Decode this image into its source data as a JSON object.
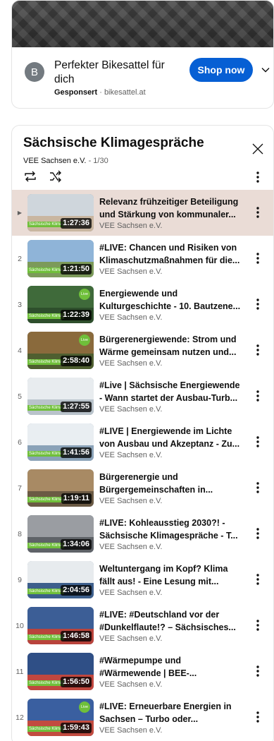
{
  "ad": {
    "avatar_letter": "B",
    "title": "Perfekter Bikesattel für dich",
    "sponsored_label": "Gesponsert",
    "separator": "·",
    "domain": "bikesattel.at",
    "shop_label": "Shop now"
  },
  "playlist": {
    "title": "Sächsische Klimagespräche",
    "channel": "VEE Sachsen e.V.",
    "separator": "-",
    "position": "1/30",
    "videos": [
      {
        "index": "▶",
        "title": "Relevanz frühzeitiger Beteiligung und Stärkung von kommunaler...",
        "channel": "VEE Sachsen e.V.",
        "duration": "1:27:36",
        "active": true,
        "sky": "#cfd6dc",
        "ground": "#c9b6a0",
        "live": false
      },
      {
        "index": "2",
        "title": "#LIVE: Chancen und Risiken von Klimaschutzmaßnahmen für die...",
        "channel": "VEE Sachsen e.V.",
        "duration": "1:21:50",
        "active": false,
        "sky": "#8fb4d8",
        "ground": "#7c9a5a",
        "live": false
      },
      {
        "index": "3",
        "title": "Energiewende und Kulturgeschichte - 10. Bautzene...",
        "channel": "VEE Sachsen e.V.",
        "duration": "1:22:39",
        "active": false,
        "sky": "#3f6a3a",
        "ground": "#2e4f2c",
        "live": true
      },
      {
        "index": "4",
        "title": "Bürgerenergiewende: Strom und Wärme gemeinsam nutzen und...",
        "channel": "VEE Sachsen e.V.",
        "duration": "2:58:40",
        "active": false,
        "sky": "#8a6a3c",
        "ground": "#4f5f30",
        "live": true
      },
      {
        "index": "5",
        "title": "#Live | Sächsische Energiewende - Wann startet der Ausbau-Turb...",
        "channel": "VEE Sachsen e.V.",
        "duration": "1:27:55",
        "active": false,
        "sky": "#e8ecef",
        "ground": "#b9c3cb",
        "live": false
      },
      {
        "index": "6",
        "title": "#LIVE | Energiewende im Lichte von Ausbau und Akzeptanz - Zu...",
        "channel": "VEE Sachsen e.V.",
        "duration": "1:41:56",
        "active": false,
        "sky": "#e9eef2",
        "ground": "#8aa2b8",
        "live": false
      },
      {
        "index": "7",
        "title": "Bürgerenergie und Bürgergemeinschaften in...",
        "channel": "VEE Sachsen e.V.",
        "duration": "1:19:11",
        "active": false,
        "sky": "#a88a64",
        "ground": "#6b5a44",
        "live": false
      },
      {
        "index": "8",
        "title": "#LIVE: Kohleausstieg 2030?! - Sächsische Klimagespräche - T...",
        "channel": "VEE Sachsen e.V.",
        "duration": "1:34:06",
        "active": false,
        "sky": "#9a9da2",
        "ground": "#5f6368",
        "live": false
      },
      {
        "index": "9",
        "title": "Weltuntergang im Kopf? Klima fällt aus! - Eine Lesung mit...",
        "channel": "VEE Sachsen e.V.",
        "duration": "2:04:56",
        "active": false,
        "sky": "#e7ebee",
        "ground": "#3d5f8c",
        "live": false
      },
      {
        "index": "10",
        "title": "#LIVE: #Deutschland vor der #Dunkelflaute!? – Sächsisches...",
        "channel": "VEE Sachsen e.V.",
        "duration": "1:46:58",
        "active": false,
        "sky": "#3c5e96",
        "ground": "#b9433c",
        "live": false
      },
      {
        "index": "11",
        "title": "#Wärmepumpe und #Wärmewende | BEE-...",
        "channel": "VEE Sachsen e.V.",
        "duration": "1:56:50",
        "active": false,
        "sky": "#2f4f86",
        "ground": "#c0473f",
        "live": false
      },
      {
        "index": "12",
        "title": "#LIVE: Erneuerbare Energien in Sachsen – Turbo oder...",
        "channel": "VEE Sachsen e.V.",
        "duration": "1:59:43",
        "active": false,
        "sky": "#3a5fa0",
        "ground": "#c24b40",
        "live": true
      }
    ]
  },
  "thumb_badge_text": "Sächsische Klimag",
  "thumb_live_text": "Live",
  "colors": {
    "accent": "#065fd4",
    "active_row": "#eadcd6",
    "badge_green": "#6fbf3a"
  },
  "icons": {
    "close": "close-icon",
    "loop": "loop-icon",
    "shuffle": "shuffle-icon",
    "more": "more-vert-icon",
    "chevron": "chevron-down-icon"
  }
}
